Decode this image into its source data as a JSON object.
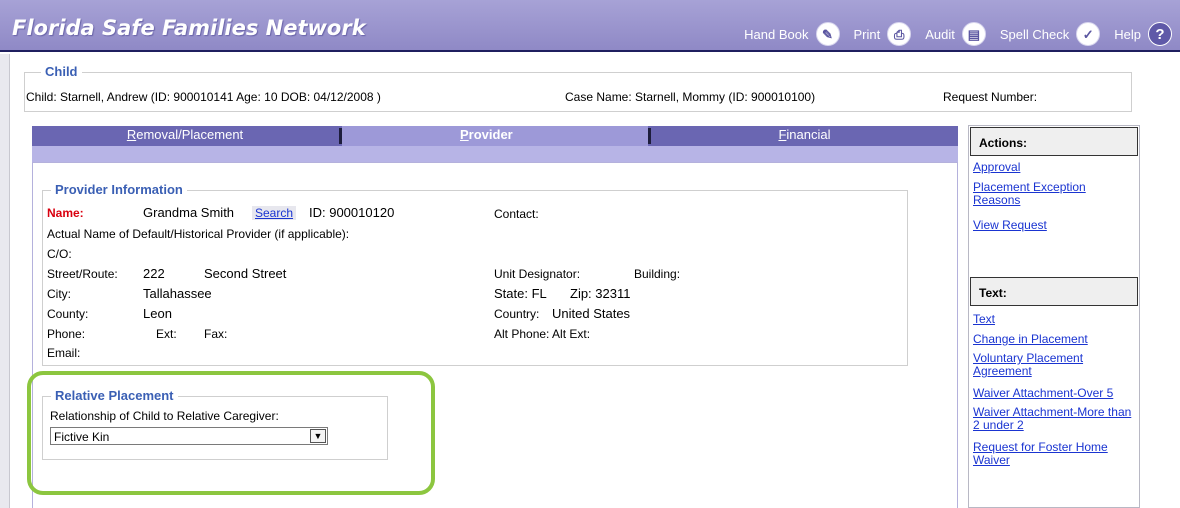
{
  "header": {
    "title": "Florida Safe Families Network",
    "tools": [
      {
        "label": "Hand Book",
        "icon": "pen-icon",
        "glyph": "✎"
      },
      {
        "label": "Print",
        "icon": "printer-icon",
        "glyph": "⎙"
      },
      {
        "label": "Audit",
        "icon": "document-icon",
        "glyph": "▤"
      },
      {
        "label": "Spell Check",
        "icon": "spell-check-icon",
        "glyph": "✓"
      },
      {
        "label": "Help",
        "icon": "help-icon",
        "glyph": "?"
      }
    ]
  },
  "child": {
    "legend": "Child",
    "child_line": "Child:   Starnell, Andrew (ID: 900010141 Age: 10 DOB: 04/12/2008 )",
    "case_line": "Case Name:   Starnell, Mommy (ID: 900010100)",
    "request_label": "Request Number:"
  },
  "tabs": [
    {
      "label": "Removal/Placement",
      "active": false
    },
    {
      "label": "Provider",
      "active": true
    },
    {
      "label": "Financial",
      "active": false
    }
  ],
  "provider": {
    "legend": "Provider Information",
    "name_label": "Name:",
    "name_value": "Grandma Smith",
    "search_label": "Search",
    "id_text": "ID:  900010120",
    "contact_label": "Contact:",
    "actual_name_label": "Actual Name of Default/Historical Provider (if applicable):",
    "co_label": "C/O:",
    "street_label": "Street/Route:",
    "street_number": "222",
    "street_name": "Second Street",
    "unit_label": "Unit Designator:",
    "building_label": "Building:",
    "city_label": "City:",
    "city_value": "Tallahassee",
    "state_text": "State: FL",
    "zip_text": "Zip:  32311",
    "county_label": "County:",
    "county_value": "Leon",
    "country_label": "Country:",
    "country_value": "United States",
    "phone_label": "Phone:",
    "ext_label": "Ext:",
    "fax_label": "Fax:",
    "alt_phone_label": "Alt Phone:   Alt Ext:",
    "email_label": "Email:"
  },
  "relative": {
    "legend": "Relative Placement",
    "question": "Relationship of Child to Relative Caregiver:",
    "selected": "Fictive Kin"
  },
  "sidebar": {
    "actions_title": "Actions:",
    "actions": [
      "Approval",
      "Placement Exception Reasons",
      "View Request"
    ],
    "text_title": "Text:",
    "text_links": [
      "Text",
      "Change in Placement",
      "Voluntary Placement Agreement",
      "Waiver Attachment-Over 5",
      "Waiver Attachment-More than 2 under 2",
      "Request for Foster Home Waiver"
    ]
  },
  "colors": {
    "header": "#9d98d2",
    "tab_bar": "#6a66b2",
    "legend_text": "#3a5fb4",
    "link": "#1a34d1",
    "highlight": "#8cc63f",
    "required_label": "#d9000f"
  }
}
